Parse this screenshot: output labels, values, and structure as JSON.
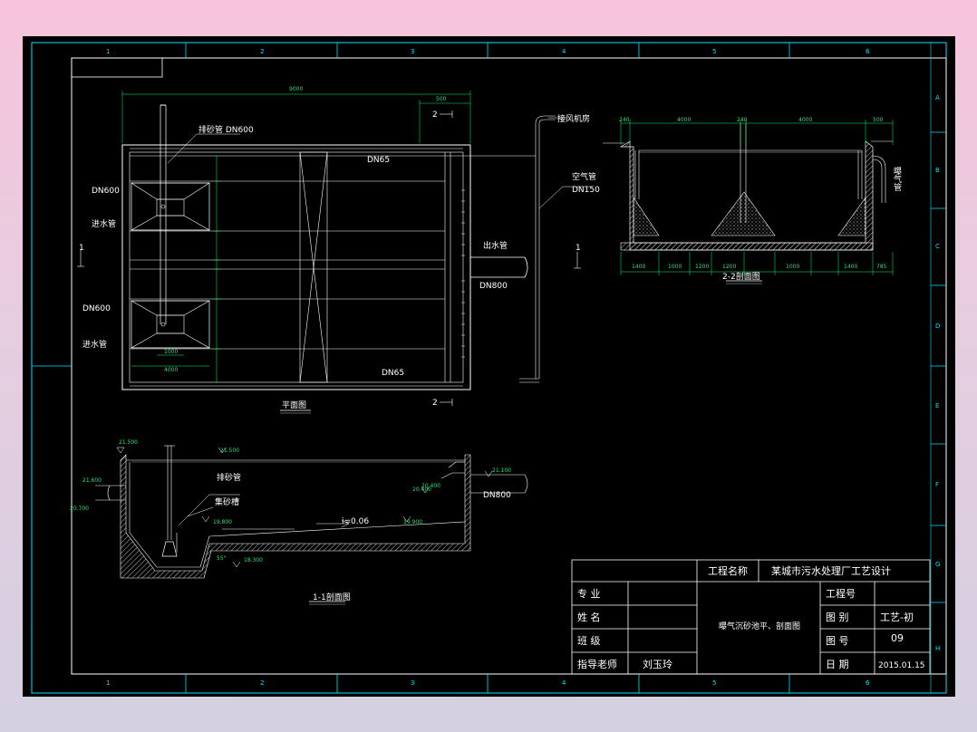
{
  "colors": {
    "background": "#000000",
    "frame": "#ffffff",
    "dims": "#00ff66",
    "border_cyan": "#00e5ff",
    "hatch": "#c8c8c8"
  },
  "border": {
    "top_numbers": [
      "1",
      "2",
      "3",
      "4",
      "5",
      "6"
    ],
    "bottom_numbers": [
      "1",
      "2",
      "3",
      "4",
      "5",
      "6"
    ],
    "right_letters": [
      "A",
      "B",
      "C",
      "D",
      "E",
      "F",
      "G",
      "H"
    ]
  },
  "plan": {
    "caption": "平面图",
    "labels": {
      "sand_pipe": "排砂管 DN600",
      "dn_top": "DN65",
      "dn_bottom": "DN65",
      "air_pipe": "空气管",
      "air_dn": "DN150",
      "blower": "接风机房",
      "outlet": "出水管",
      "outlet_dn": "DN800",
      "inlet_dn1": "DN600",
      "inlet1": "进水管",
      "inlet_dn2": "DN600",
      "inlet2": "进水管",
      "sec_1l": "1",
      "sec_1r": "1",
      "sec_2t": "2",
      "sec_2b": "2"
    },
    "dims": {
      "overall": "9000",
      "right_top": "500",
      "w1": "1000",
      "w2": "4000"
    }
  },
  "section22": {
    "caption": "2-2剖面图",
    "vertical_label": "曝气管",
    "top_dims": [
      "240",
      "4000",
      "240",
      "4000",
      "500"
    ],
    "bottom_dims": [
      "1400",
      "1000",
      "1200",
      "1200",
      "1000",
      "1400",
      "785"
    ]
  },
  "section11": {
    "caption": "1-1剖面图",
    "labels": {
      "sand_pipe": "排砂管",
      "sand_pump": "集砂槽",
      "slope": "i=0.06",
      "outlet_dn": "DN800"
    },
    "elevations": [
      "21.500",
      "21.500",
      "21.600",
      "20.700",
      "21.100",
      "20.400",
      "20.400",
      "19.900",
      "19.800",
      "18.300"
    ],
    "angle": "55°"
  },
  "title_block": {
    "project_name_label": "工程名称",
    "project_name": "某城市污水处理厂工艺设计",
    "rows": [
      {
        "label": "专  业",
        "value": ""
      },
      {
        "label": "姓  名",
        "value": ""
      },
      {
        "label": "班  级",
        "value": ""
      },
      {
        "label": "指导老师",
        "value": "刘玉玲"
      }
    ],
    "drawing_title": "曝气沉砂池平、剖面图",
    "right_rows": [
      {
        "label": "工程号",
        "value": ""
      },
      {
        "label": "图  别",
        "value": "工艺-初"
      },
      {
        "label": "图  号",
        "value": "09"
      },
      {
        "label": "日  期",
        "value": "2015.01.15"
      }
    ]
  }
}
